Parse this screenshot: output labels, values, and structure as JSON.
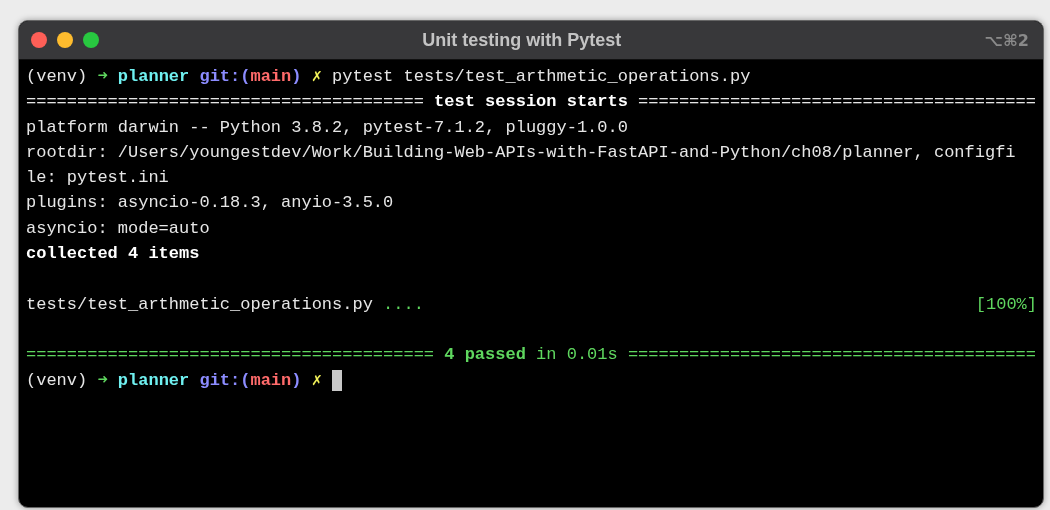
{
  "window": {
    "title": "Unit testing with Pytest",
    "shortcut": "⌥⌘2"
  },
  "blocks": [
    [
      {
        "words": [
          [
            {
              "text": "(venv)",
              "kind": "plain"
            }
          ],
          [
            {
              "text": "➜",
              "kind": "arrow"
            }
          ],
          [
            {
              "text": "planner",
              "kind": "dir"
            }
          ],
          [
            {
              "text": "git:(",
              "kind": "git"
            },
            {
              "text": "main",
              "kind": "branch"
            },
            {
              "text": ")",
              "kind": "git"
            }
          ],
          [
            {
              "text": "✗",
              "kind": "dirty"
            }
          ],
          [
            {
              "text": "pytest tests/test_arthmetic_operations.py",
              "kind": "plain"
            }
          ]
        ]
      },
      {
        "words": [
          [
            {
              "text": "=======================================",
              "kind": "plain"
            }
          ],
          [
            {
              "text": "test session starts",
              "kind": "bold"
            }
          ],
          [
            {
              "text": "=======================================",
              "kind": "plain"
            }
          ]
        ]
      },
      {
        "words": [
          [
            {
              "text": "platform darwin -- Python 3.8.2, pytest-7.1.2, pluggy-1.0.0",
              "kind": "plain"
            }
          ]
        ]
      },
      {
        "words": [
          [
            {
              "text": "rootdir: /Users/youngestdev/Work/Building-Web-APIs-with-FastAPI-and-Python/ch08/planner, configfi",
              "kind": "plain"
            }
          ]
        ]
      },
      {
        "words": [
          [
            {
              "text": "le: pytest.ini",
              "kind": "plain"
            }
          ]
        ]
      },
      {
        "words": [
          [
            {
              "text": "plugins: asyncio-0.18.3, anyio-3.5.0",
              "kind": "plain"
            }
          ]
        ]
      },
      {
        "words": [
          [
            {
              "text": "asyncio: mode=auto",
              "kind": "plain"
            }
          ]
        ]
      },
      {
        "words": [
          [
            {
              "text": "collected 4 items",
              "kind": "bold"
            }
          ]
        ]
      }
    ],
    [
      {
        "words": [
          [
            {
              "text": "tests/test_arthmetic_operations.py",
              "kind": "plain"
            }
          ],
          [
            {
              "text": "....",
              "kind": "green"
            }
          ]
        ],
        "right": [
          {
            "text": "[100%]",
            "kind": "green"
          }
        ]
      }
    ],
    [
      {
        "words": [
          [
            {
              "text": "========================================",
              "kind": "green"
            }
          ],
          [
            {
              "text": "4 passed",
              "kind": "green-bold"
            }
          ],
          [
            {
              "text": "in 0.01s",
              "kind": "green"
            }
          ],
          [
            {
              "text": "========================================",
              "kind": "green"
            }
          ]
        ]
      },
      {
        "words": [
          [
            {
              "text": "(venv)",
              "kind": "plain"
            }
          ],
          [
            {
              "text": "➜",
              "kind": "arrow"
            }
          ],
          [
            {
              "text": "planner",
              "kind": "dir"
            }
          ],
          [
            {
              "text": "git:(",
              "kind": "git"
            },
            {
              "text": "main",
              "kind": "branch"
            },
            {
              "text": ")",
              "kind": "git"
            }
          ],
          [
            {
              "text": "✗",
              "kind": "dirty"
            }
          ]
        ],
        "cursor": true
      }
    ]
  ]
}
